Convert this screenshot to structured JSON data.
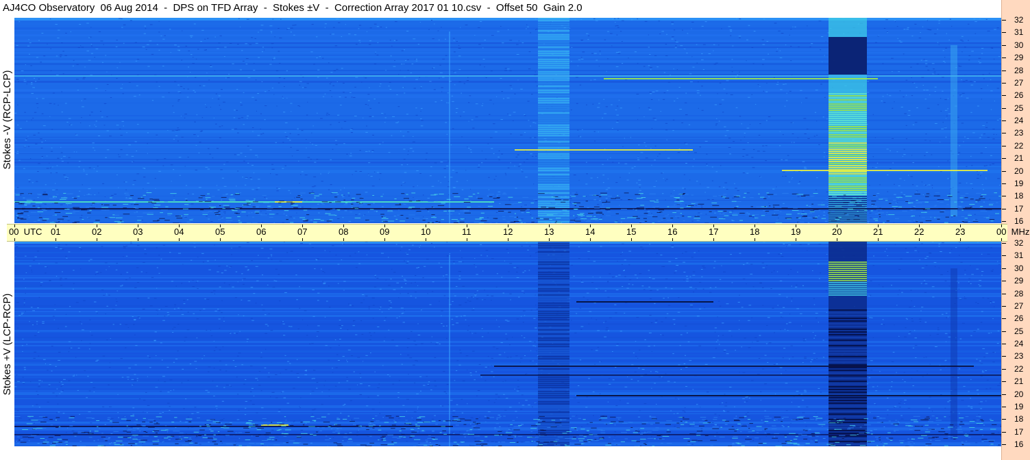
{
  "title": "AJ4CO Observatory  06 Aug 2014  -  DPS on TFD Array  -  Stokes ±V  -  Correction Array 2017 01 10.csv  -  Offset 50  Gain 2.0",
  "top_panel": {
    "ylabel": "Stokes -V (RCP-LCP)"
  },
  "bottom_panel": {
    "ylabel": "Stokes +V (LCP-RCP)"
  },
  "freq_axis": {
    "unit": "MHz",
    "labels": [
      "32",
      "31",
      "30",
      "29",
      "28",
      "27",
      "26",
      "25",
      "24",
      "23",
      "22",
      "21",
      "20",
      "19",
      "18",
      "17",
      "16"
    ]
  },
  "time_axis": {
    "labels": [
      "00  UTC",
      "01",
      "02",
      "03",
      "04",
      "05",
      "06",
      "07",
      "08",
      "09",
      "10",
      "11",
      "12",
      "13",
      "14",
      "15",
      "16",
      "17",
      "18",
      "19",
      "20",
      "21",
      "22",
      "23",
      "00  MHz"
    ]
  },
  "colors": {
    "background_blue": "#1a66e8",
    "axis_band": "#ffffc0",
    "scale_band": "#ffd9bf"
  }
}
